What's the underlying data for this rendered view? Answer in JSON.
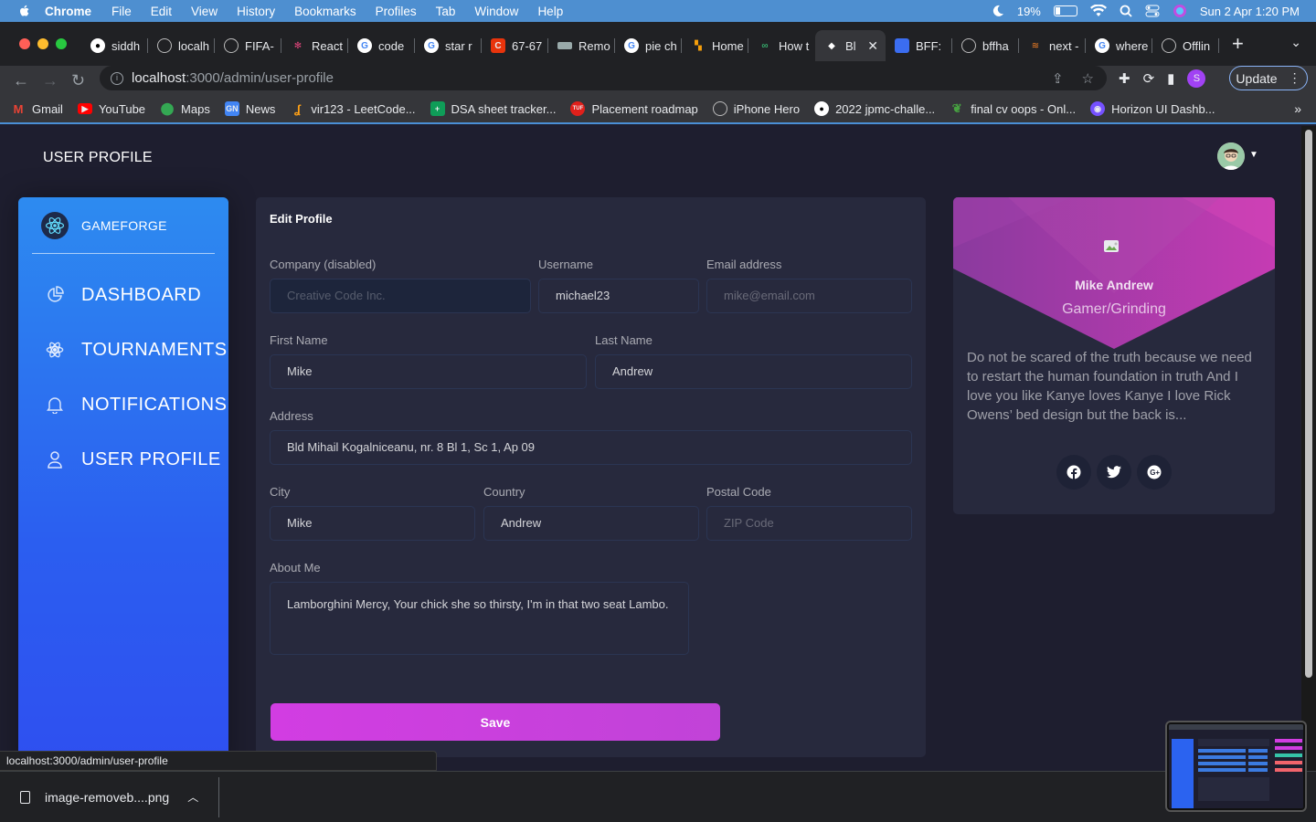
{
  "macos": {
    "app_name": "Chrome",
    "menus": [
      "File",
      "Edit",
      "View",
      "History",
      "Bookmarks",
      "Profiles",
      "Tab",
      "Window",
      "Help"
    ],
    "battery": "19%",
    "datetime": "Sun 2 Apr  1:20 PM"
  },
  "browser": {
    "tabs": [
      {
        "label": "siddh",
        "icon": "github-icon"
      },
      {
        "label": "localh",
        "icon": "globe-icon"
      },
      {
        "label": "FIFA-",
        "icon": "globe-icon"
      },
      {
        "label": "React",
        "icon": "react-icon"
      },
      {
        "label": "code",
        "icon": "google-icon"
      },
      {
        "label": "star r",
        "icon": "google-icon"
      },
      {
        "label": "67-67",
        "icon": "codechef-icon"
      },
      {
        "label": "Remo",
        "icon": "remove-bg-icon"
      },
      {
        "label": "pie ch",
        "icon": "google-icon"
      },
      {
        "label": "Home",
        "icon": "home-icon"
      },
      {
        "label": "How t",
        "icon": "link-icon"
      },
      {
        "label": "Bl",
        "icon": "game-icon",
        "active": true
      },
      {
        "label": "BFF: ",
        "icon": "bff-icon"
      },
      {
        "label": "bffha",
        "icon": "globe-icon"
      },
      {
        "label": "next -",
        "icon": "stack-icon"
      },
      {
        "label": "where",
        "icon": "google-icon"
      },
      {
        "label": "Offlin",
        "icon": "globe-icon"
      }
    ],
    "url_host": "localhost",
    "url_path": ":3000/admin/user-profile",
    "profile_initial": "S",
    "update_label": "Update",
    "bookmarks": [
      {
        "label": "Gmail",
        "icon": "gmail-icon"
      },
      {
        "label": "YouTube",
        "icon": "youtube-icon"
      },
      {
        "label": "Maps",
        "icon": "maps-icon"
      },
      {
        "label": "News",
        "icon": "news-icon"
      },
      {
        "label": "vir123 - LeetCode...",
        "icon": "leetcode-icon"
      },
      {
        "label": "DSA sheet tracker...",
        "icon": "sheets-icon"
      },
      {
        "label": "Placement roadmap",
        "icon": "tuf-icon"
      },
      {
        "label": "iPhone Hero",
        "icon": "globe-icon"
      },
      {
        "label": "2022 jpmc-challe...",
        "icon": "github-icon"
      },
      {
        "label": "final cv oops - Onl...",
        "icon": "overleaf-icon"
      },
      {
        "label": "Horizon UI Dashb...",
        "icon": "horizon-icon"
      }
    ],
    "status_url": "localhost:3000/admin/user-profile",
    "download_file": "image-removeb....png"
  },
  "page": {
    "title": "USER PROFILE",
    "brand": "GAMEFORGE",
    "nav": [
      {
        "label": "DASHBOARD",
        "icon": "chart-pie-icon"
      },
      {
        "label": "TOURNAMENTS",
        "icon": "atom-icon"
      },
      {
        "label": "NOTIFICATIONS",
        "icon": "bell-icon"
      },
      {
        "label": "USER PROFILE",
        "icon": "user-icon"
      }
    ],
    "form": {
      "title": "Edit Profile",
      "company_label": "Company (disabled)",
      "company_value": "Creative Code Inc.",
      "username_label": "Username",
      "username_value": "michael23",
      "email_label": "Email address",
      "email_placeholder": "mike@email.com",
      "first_name_label": "First Name",
      "first_name_value": "Mike",
      "last_name_label": "Last Name",
      "last_name_value": "Andrew",
      "address_label": "Address",
      "address_value": "Bld Mihail Kogalniceanu, nr. 8 Bl 1, Sc 1, Ap 09",
      "city_label": "City",
      "city_value": "Mike",
      "country_label": "Country",
      "country_value": "Andrew",
      "postal_label": "Postal Code",
      "postal_placeholder": "ZIP Code",
      "about_label": "About Me",
      "about_value": "Lamborghini Mercy, Your chick she so thirsty, I'm in that two seat Lambo.",
      "save_label": "Save"
    },
    "profile_card": {
      "name": "Mike Andrew",
      "role": "Gamer/Grinding",
      "bio": "Do not be scared of the truth because we need to restart the human foundation in truth And I love you like Kanye loves Kanye I love Rick Owens’ bed design but the back is...",
      "socials": [
        "facebook-icon",
        "twitter-icon",
        "google-plus-icon"
      ]
    }
  },
  "colors": {
    "mac_menubar": "#4e8fd0",
    "page_bg": "#1e1e2f",
    "card_bg": "#27293d",
    "sidebar_gradient": [
      "#2d8bf0",
      "#2f4ff0"
    ],
    "save_button": "#d23de2",
    "banner_magenta": "#b636a8"
  }
}
